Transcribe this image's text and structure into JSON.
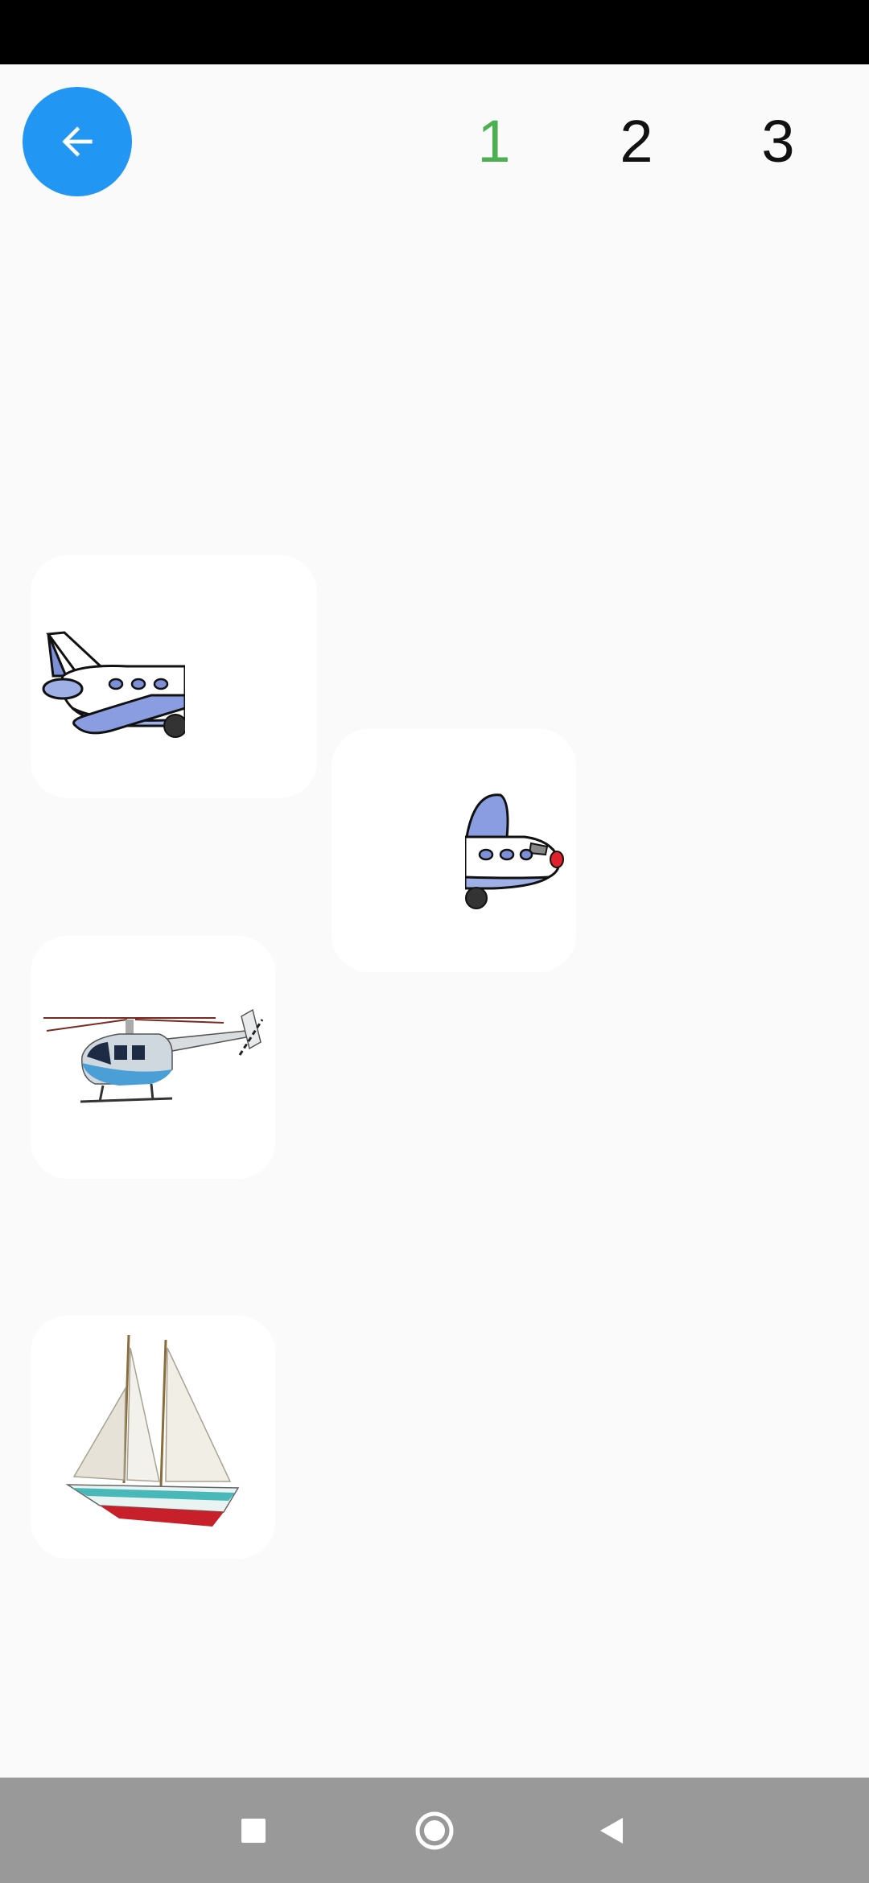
{
  "header": {
    "back_icon": "arrow-left-icon",
    "accent_color": "#2196f3",
    "levels": [
      {
        "label": "1",
        "active": true
      },
      {
        "label": "2",
        "active": false
      },
      {
        "label": "3",
        "active": false
      }
    ],
    "active_color": "#4caf50"
  },
  "cards": [
    {
      "icon": "airplane-tail-half-icon"
    },
    {
      "icon": "airplane-nose-half-icon"
    },
    {
      "icon": "helicopter-icon"
    },
    {
      "icon": "sailboat-icon"
    }
  ],
  "nav_bar": {
    "recent_icon": "square-icon",
    "home_icon": "circle-icon",
    "back_icon": "triangle-back-icon"
  }
}
